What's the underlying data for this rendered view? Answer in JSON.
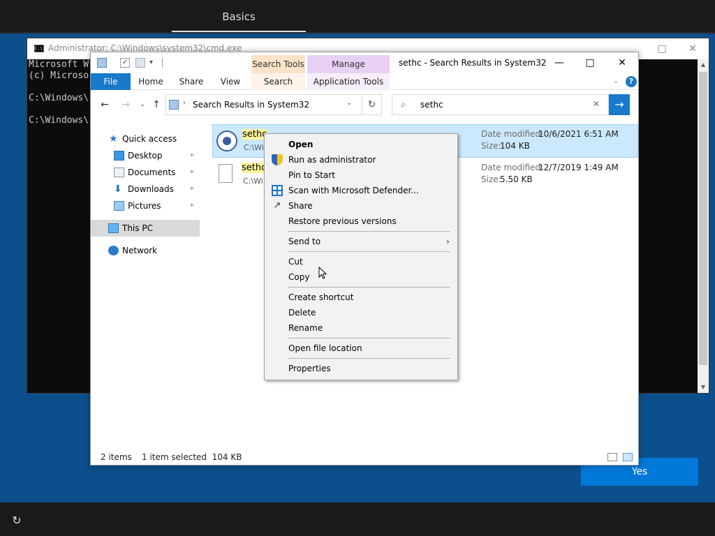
{
  "oobe": {
    "tab": "Basics",
    "yes_label": "Yes"
  },
  "cmd": {
    "title": "Administrator: C:\\Windows\\system32\\cmd.exe",
    "lines": [
      "Microsoft W",
      "(c) Microso",
      "",
      "C:\\Windows\\",
      "",
      "C:\\Windows\\"
    ]
  },
  "explorer": {
    "title": "sethc - Search Results in System32",
    "context_tab_search": "Search Tools",
    "context_tab_manage": "Manage",
    "tabs": [
      "File",
      "Home",
      "Share",
      "View",
      "Search",
      "Application Tools"
    ],
    "address": "Search Results in System32",
    "search_value": "sethc",
    "nav": [
      {
        "label": "Quick access"
      },
      {
        "label": "Desktop"
      },
      {
        "label": "Documents"
      },
      {
        "label": "Downloads"
      },
      {
        "label": "Pictures"
      },
      {
        "label": "This PC"
      },
      {
        "label": "Network"
      }
    ],
    "files": [
      {
        "name": "sethc",
        "path": "C:\\Wi",
        "date_key": "Date modified:",
        "date": "10/6/2021 6:51 AM",
        "size_key": "Size:",
        "size": "104 KB"
      },
      {
        "name": "sethc",
        "path": "C:\\Wi",
        "date_key": "Date modified:",
        "date": "12/7/2019 1:49 AM",
        "size_key": "Size:",
        "size": "5.50 KB"
      }
    ],
    "status": {
      "count": "2 items",
      "selection": "1 item selected  104 KB"
    }
  },
  "context_menu": {
    "items": [
      "Open",
      "Run as administrator",
      "Pin to Start",
      "Scan with Microsoft Defender...",
      "Share",
      "Restore previous versions",
      "Send to",
      "Cut",
      "Copy",
      "Create shortcut",
      "Delete",
      "Rename",
      "Open file location",
      "Properties"
    ]
  },
  "colors": {
    "accent": "#1979ca",
    "oobe_bg": "#0d4f8c",
    "search_tools": "#fbe2c8",
    "manage": "#e8d0f5",
    "selection": "#cce8ff",
    "highlight": "#fff59a"
  }
}
